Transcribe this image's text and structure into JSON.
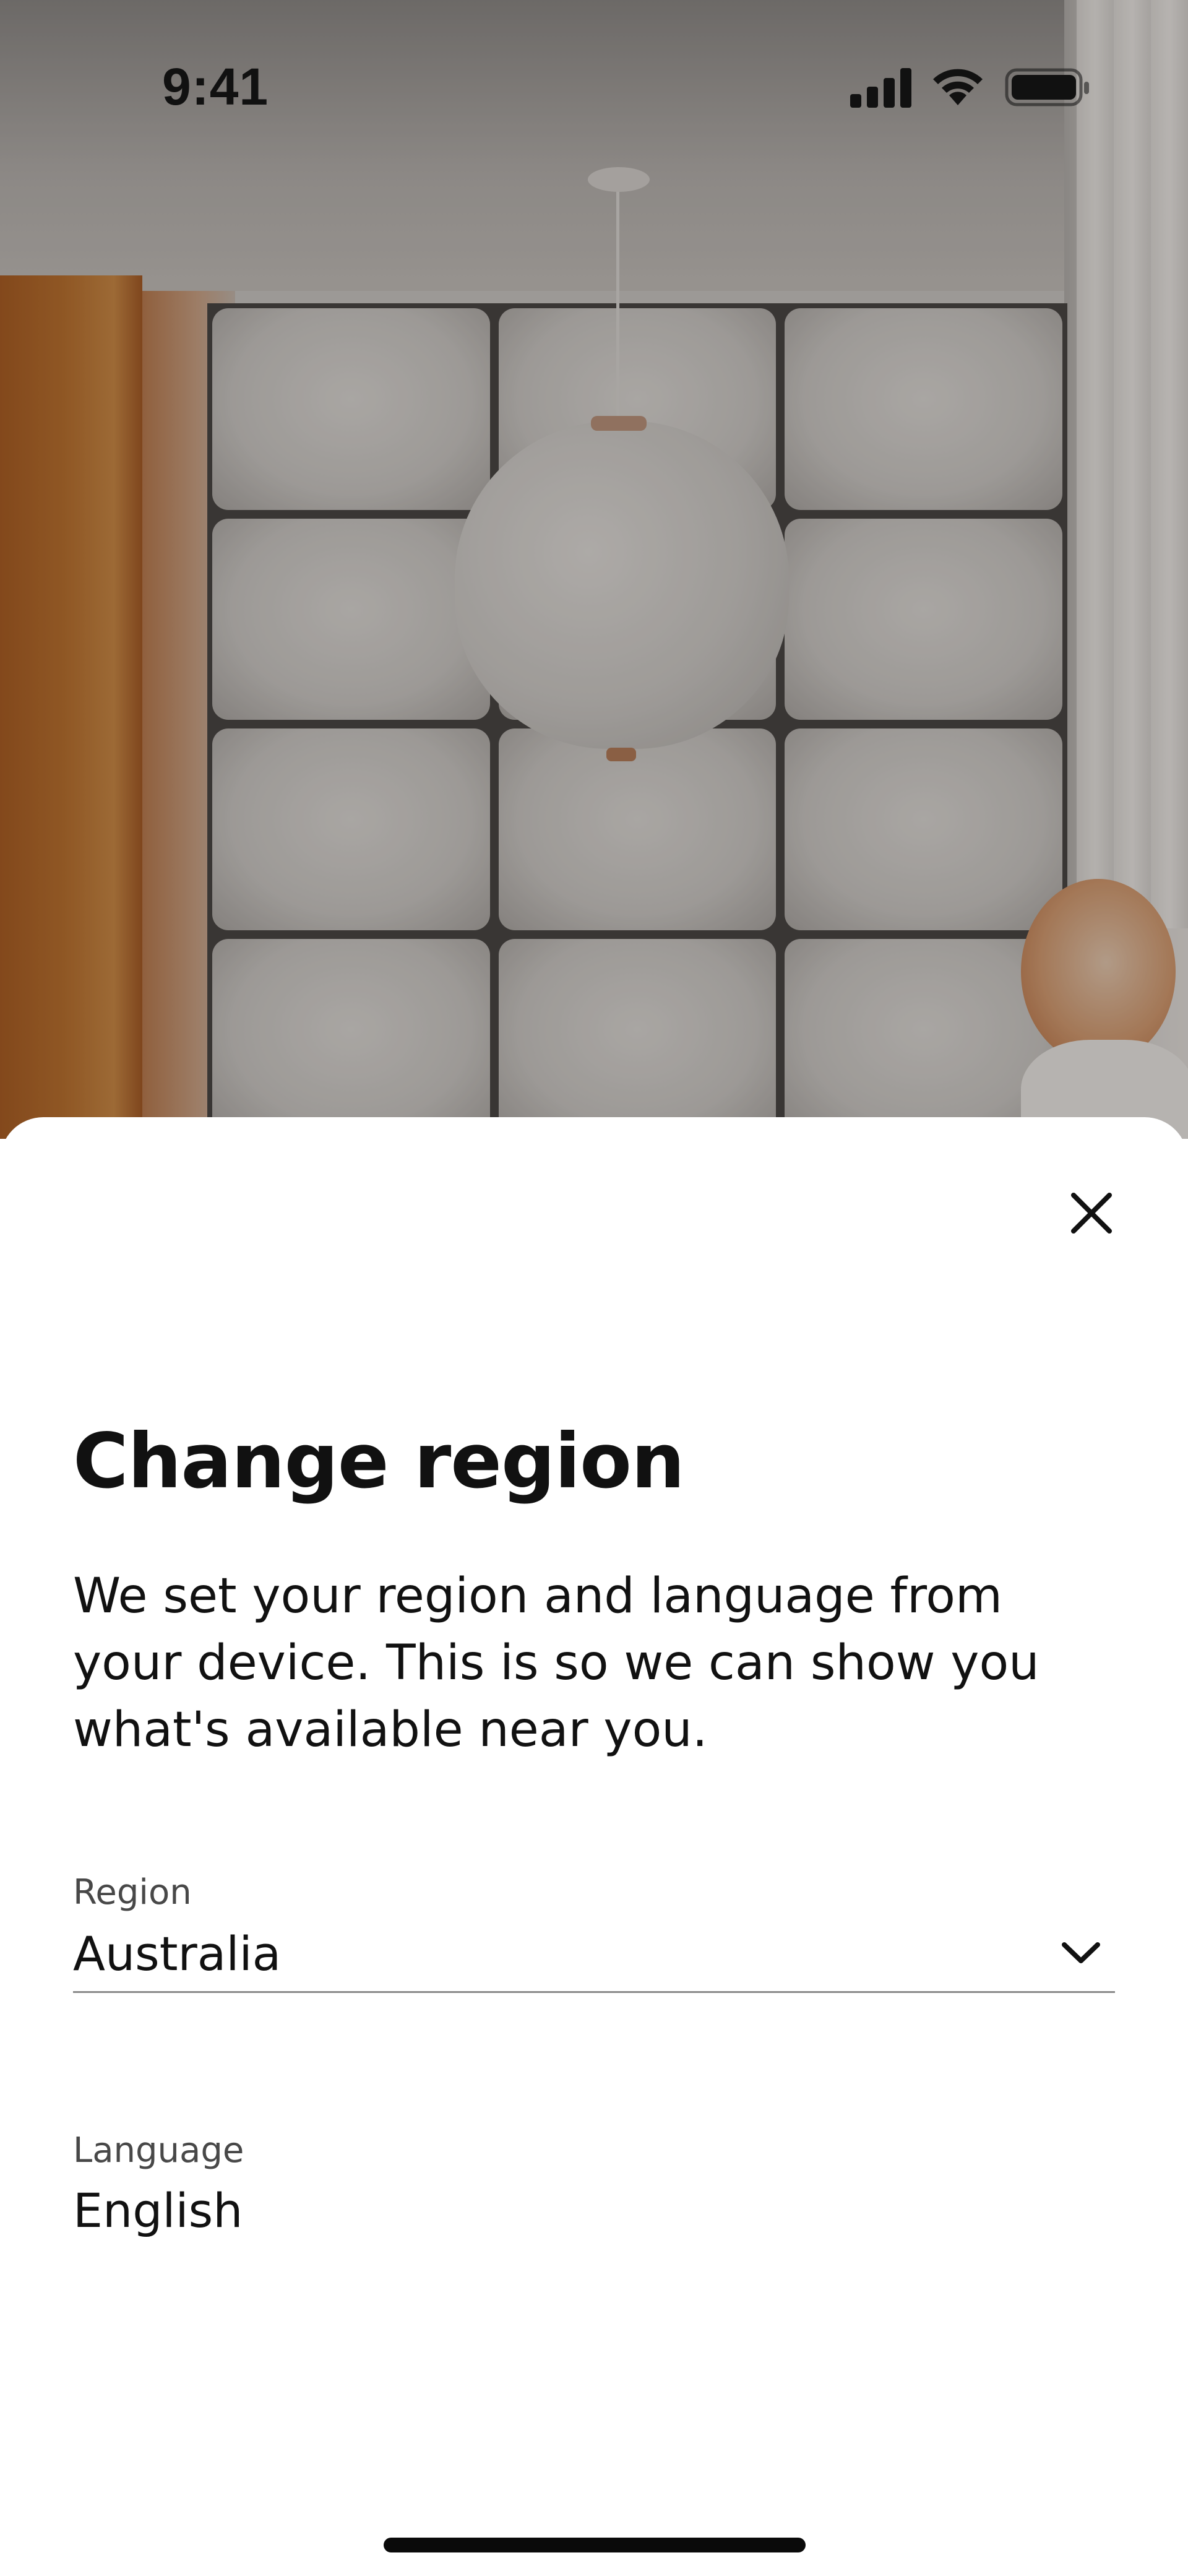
{
  "status_bar": {
    "time": "9:41",
    "icons": [
      "signal-icon",
      "wifi-icon",
      "battery-icon"
    ]
  },
  "sheet": {
    "close_icon": "close-icon",
    "title": "Change region",
    "description": "We set your region and language from your device. This is so we can show you what's available near you.",
    "region": {
      "label": "Region",
      "value": "Australia",
      "icon": "chevron-down-icon"
    },
    "language": {
      "label": "Language",
      "value": "English"
    }
  },
  "colors": {
    "text": "#111111",
    "label": "#484848",
    "underline": "#8a8a8a",
    "sheet_background": "#ffffff"
  }
}
